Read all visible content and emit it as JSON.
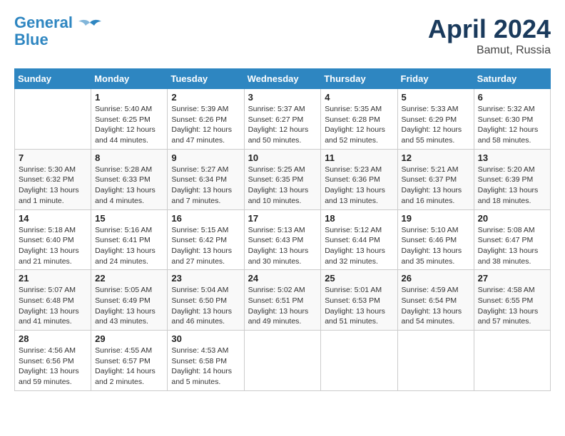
{
  "logo": {
    "line1": "General",
    "line2": "Blue"
  },
  "title": "April 2024",
  "location": "Bamut, Russia",
  "days_header": [
    "Sunday",
    "Monday",
    "Tuesday",
    "Wednesday",
    "Thursday",
    "Friday",
    "Saturday"
  ],
  "weeks": [
    [
      {
        "day": "",
        "content": ""
      },
      {
        "day": "1",
        "content": "Sunrise: 5:40 AM\nSunset: 6:25 PM\nDaylight: 12 hours\nand 44 minutes."
      },
      {
        "day": "2",
        "content": "Sunrise: 5:39 AM\nSunset: 6:26 PM\nDaylight: 12 hours\nand 47 minutes."
      },
      {
        "day": "3",
        "content": "Sunrise: 5:37 AM\nSunset: 6:27 PM\nDaylight: 12 hours\nand 50 minutes."
      },
      {
        "day": "4",
        "content": "Sunrise: 5:35 AM\nSunset: 6:28 PM\nDaylight: 12 hours\nand 52 minutes."
      },
      {
        "day": "5",
        "content": "Sunrise: 5:33 AM\nSunset: 6:29 PM\nDaylight: 12 hours\nand 55 minutes."
      },
      {
        "day": "6",
        "content": "Sunrise: 5:32 AM\nSunset: 6:30 PM\nDaylight: 12 hours\nand 58 minutes."
      }
    ],
    [
      {
        "day": "7",
        "content": "Sunrise: 5:30 AM\nSunset: 6:32 PM\nDaylight: 13 hours\nand 1 minute."
      },
      {
        "day": "8",
        "content": "Sunrise: 5:28 AM\nSunset: 6:33 PM\nDaylight: 13 hours\nand 4 minutes."
      },
      {
        "day": "9",
        "content": "Sunrise: 5:27 AM\nSunset: 6:34 PM\nDaylight: 13 hours\nand 7 minutes."
      },
      {
        "day": "10",
        "content": "Sunrise: 5:25 AM\nSunset: 6:35 PM\nDaylight: 13 hours\nand 10 minutes."
      },
      {
        "day": "11",
        "content": "Sunrise: 5:23 AM\nSunset: 6:36 PM\nDaylight: 13 hours\nand 13 minutes."
      },
      {
        "day": "12",
        "content": "Sunrise: 5:21 AM\nSunset: 6:37 PM\nDaylight: 13 hours\nand 16 minutes."
      },
      {
        "day": "13",
        "content": "Sunrise: 5:20 AM\nSunset: 6:39 PM\nDaylight: 13 hours\nand 18 minutes."
      }
    ],
    [
      {
        "day": "14",
        "content": "Sunrise: 5:18 AM\nSunset: 6:40 PM\nDaylight: 13 hours\nand 21 minutes."
      },
      {
        "day": "15",
        "content": "Sunrise: 5:16 AM\nSunset: 6:41 PM\nDaylight: 13 hours\nand 24 minutes."
      },
      {
        "day": "16",
        "content": "Sunrise: 5:15 AM\nSunset: 6:42 PM\nDaylight: 13 hours\nand 27 minutes."
      },
      {
        "day": "17",
        "content": "Sunrise: 5:13 AM\nSunset: 6:43 PM\nDaylight: 13 hours\nand 30 minutes."
      },
      {
        "day": "18",
        "content": "Sunrise: 5:12 AM\nSunset: 6:44 PM\nDaylight: 13 hours\nand 32 minutes."
      },
      {
        "day": "19",
        "content": "Sunrise: 5:10 AM\nSunset: 6:46 PM\nDaylight: 13 hours\nand 35 minutes."
      },
      {
        "day": "20",
        "content": "Sunrise: 5:08 AM\nSunset: 6:47 PM\nDaylight: 13 hours\nand 38 minutes."
      }
    ],
    [
      {
        "day": "21",
        "content": "Sunrise: 5:07 AM\nSunset: 6:48 PM\nDaylight: 13 hours\nand 41 minutes."
      },
      {
        "day": "22",
        "content": "Sunrise: 5:05 AM\nSunset: 6:49 PM\nDaylight: 13 hours\nand 43 minutes."
      },
      {
        "day": "23",
        "content": "Sunrise: 5:04 AM\nSunset: 6:50 PM\nDaylight: 13 hours\nand 46 minutes."
      },
      {
        "day": "24",
        "content": "Sunrise: 5:02 AM\nSunset: 6:51 PM\nDaylight: 13 hours\nand 49 minutes."
      },
      {
        "day": "25",
        "content": "Sunrise: 5:01 AM\nSunset: 6:53 PM\nDaylight: 13 hours\nand 51 minutes."
      },
      {
        "day": "26",
        "content": "Sunrise: 4:59 AM\nSunset: 6:54 PM\nDaylight: 13 hours\nand 54 minutes."
      },
      {
        "day": "27",
        "content": "Sunrise: 4:58 AM\nSunset: 6:55 PM\nDaylight: 13 hours\nand 57 minutes."
      }
    ],
    [
      {
        "day": "28",
        "content": "Sunrise: 4:56 AM\nSunset: 6:56 PM\nDaylight: 13 hours\nand 59 minutes."
      },
      {
        "day": "29",
        "content": "Sunrise: 4:55 AM\nSunset: 6:57 PM\nDaylight: 14 hours\nand 2 minutes."
      },
      {
        "day": "30",
        "content": "Sunrise: 4:53 AM\nSunset: 6:58 PM\nDaylight: 14 hours\nand 5 minutes."
      },
      {
        "day": "",
        "content": ""
      },
      {
        "day": "",
        "content": ""
      },
      {
        "day": "",
        "content": ""
      },
      {
        "day": "",
        "content": ""
      }
    ]
  ]
}
